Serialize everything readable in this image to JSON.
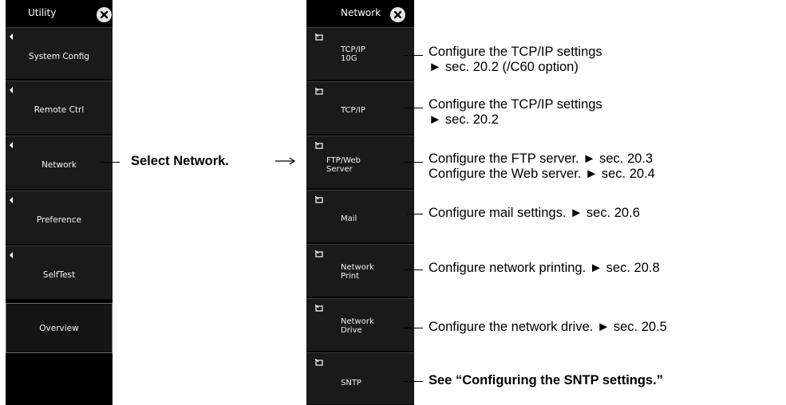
{
  "utility": {
    "title": "Utility",
    "close_icon": "close-circle-icon",
    "items": [
      {
        "label": "System Config"
      },
      {
        "label": "Remote Ctrl"
      },
      {
        "label": "Network"
      },
      {
        "label": "Preference"
      },
      {
        "label": "SelfTest"
      },
      {
        "label": "Overview"
      }
    ]
  },
  "select_instruction": "Select Network.",
  "network": {
    "title": "Network",
    "close_icon": "close-circle-icon",
    "items": [
      {
        "label_line1": "TCP/IP",
        "label_line2": "10G"
      },
      {
        "label_line1": "TCP/IP",
        "label_line2": ""
      },
      {
        "label_line1": "FTP/Web",
        "label_line2": "Server"
      },
      {
        "label_line1": "Mail",
        "label_line2": ""
      },
      {
        "label_line1": "Network",
        "label_line2": "Print"
      },
      {
        "label_line1": "Network",
        "label_line2": "Drive"
      },
      {
        "label_line1": "SNTP",
        "label_line2": ""
      }
    ]
  },
  "descriptions": [
    {
      "line1": "Configure the TCP/IP settings",
      "line2": "► sec. 20.2 (/C60 option)"
    },
    {
      "line1": "Configure the TCP/IP settings",
      "line2": "► sec. 20.2"
    },
    {
      "line1": "Configure the FTP server. ► sec. 20.3",
      "line2": "Configure the Web server. ► sec. 20.4"
    },
    {
      "line1": "Configure mail settings. ► sec. 20.6"
    },
    {
      "line1": "Configure network printing. ► sec. 20.8"
    },
    {
      "line1": "Configure the network drive. ► sec. 20.5"
    },
    {
      "line1": "See “Configuring the SNTP settings.”"
    }
  ],
  "colors": {
    "panel_bg": "#000000",
    "key_bg": "#1a1a1a",
    "text": "#ffffff"
  }
}
